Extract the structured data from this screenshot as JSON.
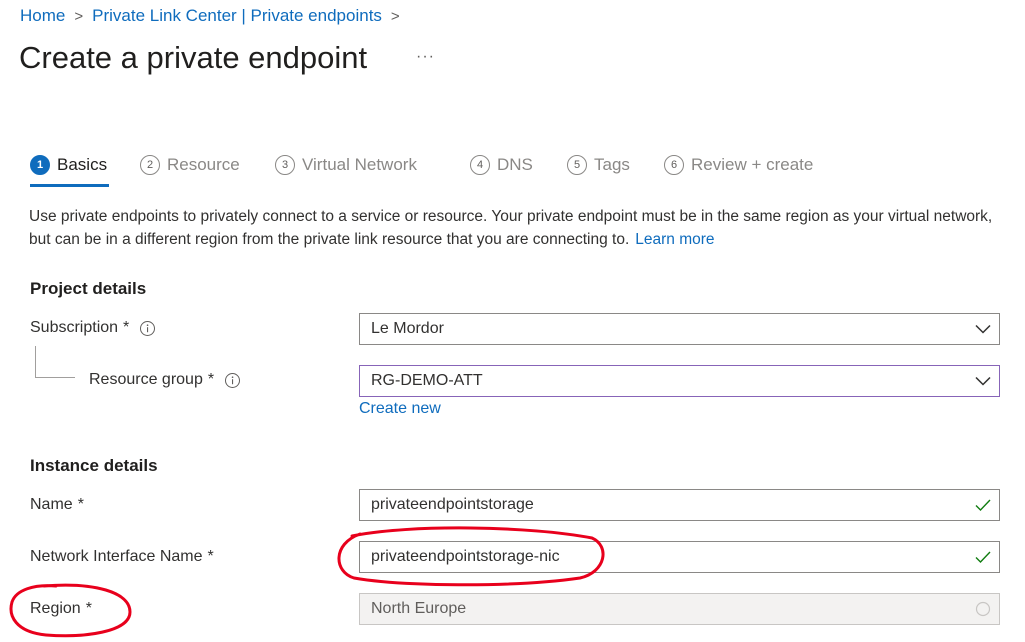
{
  "breadcrumb": {
    "home": "Home",
    "parent": "Private Link Center | Private endpoints",
    "separator": ">"
  },
  "page": {
    "title": "Create a private endpoint",
    "more": "···"
  },
  "tabs": [
    {
      "num": "1",
      "label": "Basics",
      "active": true
    },
    {
      "num": "2",
      "label": "Resource"
    },
    {
      "num": "3",
      "label": "Virtual Network"
    },
    {
      "num": "4",
      "label": "DNS"
    },
    {
      "num": "5",
      "label": "Tags"
    },
    {
      "num": "6",
      "label": "Review + create"
    }
  ],
  "intro": {
    "text": "Use private endpoints to privately connect to a service or resource. Your private endpoint must be in the same region as your virtual network, but can be in a different region from the private link resource that you are connecting to.",
    "learn_more": "Learn more"
  },
  "project": {
    "heading": "Project details",
    "subscription": {
      "label": "Subscription",
      "required": "*",
      "value": "Le Mordor"
    },
    "resource_group": {
      "label": "Resource group",
      "required": "*",
      "value": "RG-DEMO-ATT",
      "create_new": "Create new"
    }
  },
  "instance": {
    "heading": "Instance details",
    "name": {
      "label": "Name",
      "required": "*",
      "value": "privateendpointstorage"
    },
    "nic_name": {
      "label": "Network Interface Name",
      "required": "*",
      "value": "privateendpointstorage-nic"
    },
    "region": {
      "label": "Region",
      "required": "*",
      "value": "North Europe"
    }
  },
  "colors": {
    "accent": "#0f6cbd",
    "annotation": "#e8001c",
    "valid": "#107c10"
  },
  "icons": [
    "chevron-right-icon",
    "more-icon",
    "info-icon",
    "chevron-down-icon",
    "checkmark-icon",
    "spinner-icon"
  ]
}
